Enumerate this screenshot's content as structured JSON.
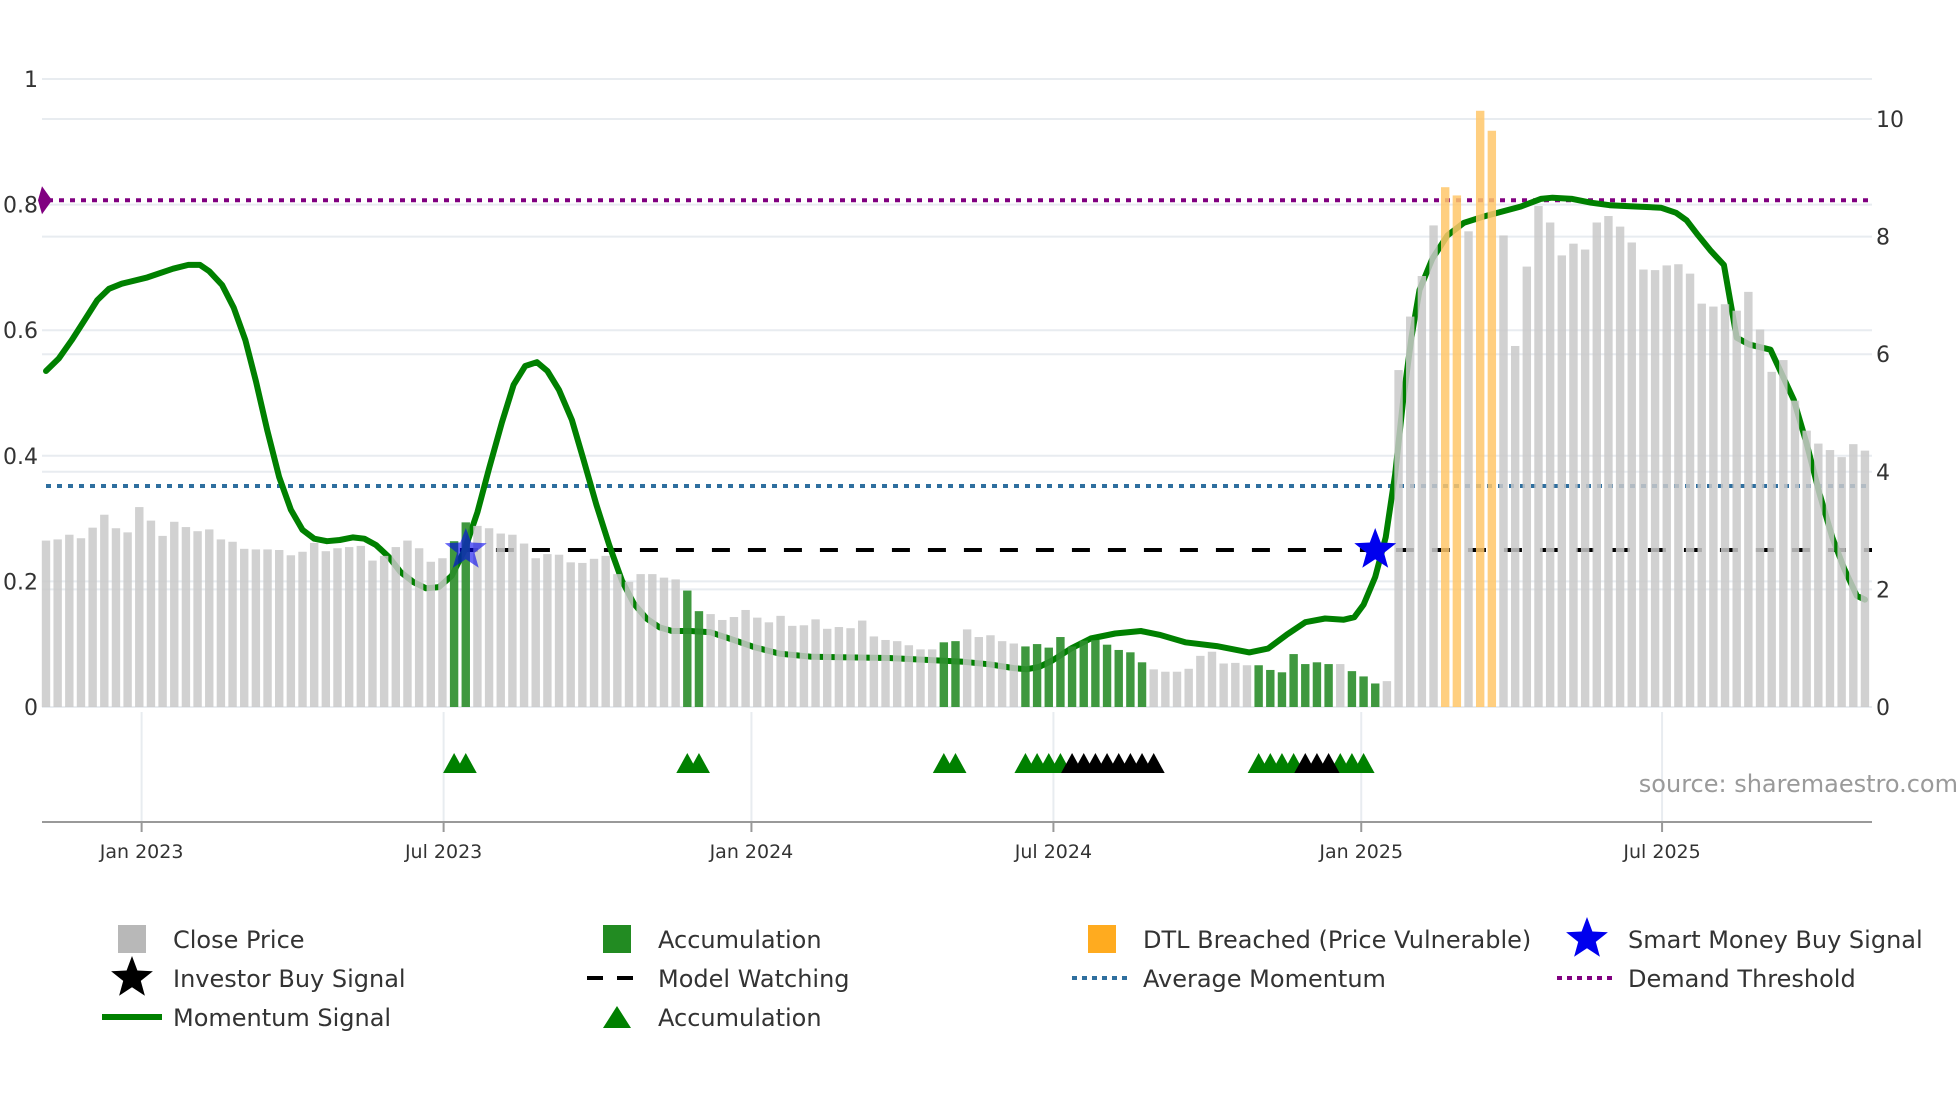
{
  "chart_data": {
    "type": "bar",
    "title": "",
    "x_unit": "week index (weekly bars)",
    "x_ticks": [
      {
        "label": "Jan 2023",
        "week": 8.2
      },
      {
        "label": "Jul 2023",
        "week": 34.1
      },
      {
        "label": "Jan 2024",
        "week": 60.5
      },
      {
        "label": "Jul 2024",
        "week": 86.4
      },
      {
        "label": "Jan 2025",
        "week": 112.8
      },
      {
        "label": "Jul 2025",
        "week": 138.6
      }
    ],
    "y_left": {
      "ticks": [
        "0",
        "0.2",
        "0.4",
        "0.6",
        "0.8",
        "1"
      ],
      "range": [
        0,
        1
      ]
    },
    "y_right": {
      "ticks": [
        "0",
        "2",
        "4",
        "6",
        "8",
        "10"
      ],
      "range": [
        0,
        10
      ]
    },
    "grid": true,
    "close_price": [
      2.83,
      2.85,
      2.93,
      2.87,
      3.05,
      3.27,
      3.04,
      2.97,
      3.4,
      3.17,
      2.91,
      3.15,
      3.06,
      2.99,
      3.02,
      2.85,
      2.81,
      2.69,
      2.68,
      2.68,
      2.67,
      2.58,
      2.64,
      2.79,
      2.65,
      2.7,
      2.72,
      2.74,
      2.49,
      2.57,
      2.72,
      2.83,
      2.7,
      2.47,
      2.53,
      2.82,
      3.14,
      3.08,
      3.04,
      2.95,
      2.93,
      2.78,
      2.53,
      2.6,
      2.59,
      2.46,
      2.45,
      2.52,
      2.57,
      2.26,
      2.13,
      2.26,
      2.26,
      2.2,
      2.17,
      1.98,
      1.63,
      1.58,
      1.48,
      1.53,
      1.65,
      1.52,
      1.44,
      1.55,
      1.38,
      1.39,
      1.49,
      1.33,
      1.36,
      1.34,
      1.47,
      1.2,
      1.14,
      1.12,
      1.05,
      0.98,
      0.98,
      1.1,
      1.12,
      1.32,
      1.19,
      1.22,
      1.12,
      1.08,
      1.03,
      1.07,
      1.01,
      1.19,
      1.03,
      1.13,
      1.14,
      1.06,
      0.97,
      0.93,
      0.76,
      0.64,
      0.6,
      0.6,
      0.65,
      0.87,
      0.94,
      0.74,
      0.75,
      0.71,
      0.71,
      0.63,
      0.59,
      0.9,
      0.73,
      0.76,
      0.73,
      0.73,
      0.61,
      0.52,
      0.4,
      0.44,
      5.73,
      6.64,
      7.33,
      8.19,
      8.84,
      8.7,
      8.09,
      10.14,
      9.8,
      8.02,
      6.14,
      7.49,
      8.52,
      8.24,
      7.68,
      7.88,
      7.78,
      8.24,
      8.35,
      8.17,
      7.9,
      7.44,
      7.43,
      7.51,
      7.53,
      7.37,
      6.86,
      6.81,
      6.85,
      6.74,
      7.06,
      6.42,
      5.7,
      5.9,
      5.21,
      4.7,
      4.48,
      4.37,
      4.25,
      4.47,
      4.36
    ],
    "accumulation_weeks": [
      35,
      36,
      55,
      56,
      77,
      78,
      84,
      85,
      86,
      87,
      88,
      89,
      90,
      91,
      92,
      93,
      94,
      104,
      105,
      106,
      107,
      108,
      109,
      110,
      112,
      113,
      114
    ],
    "dtl_breached_weeks": [
      120,
      121,
      123,
      124
    ],
    "momentum_signal": [
      [
        0,
        0.535
      ],
      [
        1.1,
        0.555
      ],
      [
        2.2,
        0.584
      ],
      [
        3.3,
        0.616
      ],
      [
        4.4,
        0.648
      ],
      [
        5.4,
        0.666
      ],
      [
        6.5,
        0.674
      ],
      [
        8.7,
        0.684
      ],
      [
        10.9,
        0.698
      ],
      [
        12.2,
        0.704
      ],
      [
        13.2,
        0.704
      ],
      [
        14.0,
        0.694
      ],
      [
        15.1,
        0.672
      ],
      [
        16.1,
        0.636
      ],
      [
        17.1,
        0.584
      ],
      [
        18.0,
        0.519
      ],
      [
        19.0,
        0.439
      ],
      [
        20.0,
        0.366
      ],
      [
        21.0,
        0.314
      ],
      [
        22.0,
        0.282
      ],
      [
        23.0,
        0.268
      ],
      [
        24.1,
        0.264
      ],
      [
        25.2,
        0.266
      ],
      [
        26.3,
        0.27
      ],
      [
        27.3,
        0.268
      ],
      [
        28.3,
        0.258
      ],
      [
        29.4,
        0.239
      ],
      [
        30.4,
        0.215
      ],
      [
        31.5,
        0.199
      ],
      [
        32.6,
        0.189
      ],
      [
        33.7,
        0.191
      ],
      [
        34.8,
        0.209
      ],
      [
        35.9,
        0.25
      ],
      [
        37.0,
        0.31
      ],
      [
        38.0,
        0.38
      ],
      [
        39.1,
        0.453
      ],
      [
        40.1,
        0.513
      ],
      [
        41.1,
        0.543
      ],
      [
        42.1,
        0.549
      ],
      [
        43.0,
        0.535
      ],
      [
        44.0,
        0.505
      ],
      [
        45.1,
        0.457
      ],
      [
        46.1,
        0.394
      ],
      [
        47.2,
        0.322
      ],
      [
        48.3,
        0.258
      ],
      [
        49.4,
        0.201
      ],
      [
        50.4,
        0.165
      ],
      [
        51.5,
        0.141
      ],
      [
        52.6,
        0.127
      ],
      [
        53.7,
        0.121
      ],
      [
        55.3,
        0.121
      ],
      [
        57.0,
        0.119
      ],
      [
        58.6,
        0.109
      ],
      [
        60.8,
        0.095
      ],
      [
        62.9,
        0.085
      ],
      [
        65.7,
        0.08
      ],
      [
        72.2,
        0.078
      ],
      [
        78.7,
        0.072
      ],
      [
        80.9,
        0.068
      ],
      [
        83.0,
        0.062
      ],
      [
        84.1,
        0.06
      ],
      [
        85.2,
        0.064
      ],
      [
        86.3,
        0.074
      ],
      [
        87.9,
        0.093
      ],
      [
        89.6,
        0.109
      ],
      [
        91.7,
        0.117
      ],
      [
        93.9,
        0.121
      ],
      [
        95.5,
        0.115
      ],
      [
        97.7,
        0.103
      ],
      [
        100.4,
        0.097
      ],
      [
        103.2,
        0.087
      ],
      [
        104.8,
        0.093
      ],
      [
        106.4,
        0.115
      ],
      [
        108.0,
        0.135
      ],
      [
        109.7,
        0.141
      ],
      [
        111.3,
        0.139
      ],
      [
        112.2,
        0.143
      ],
      [
        113.0,
        0.163
      ],
      [
        114.0,
        0.207
      ],
      [
        114.9,
        0.27
      ],
      [
        115.7,
        0.37
      ],
      [
        116.4,
        0.489
      ],
      [
        117.1,
        0.588
      ],
      [
        117.8,
        0.664
      ],
      [
        118.9,
        0.714
      ],
      [
        120.2,
        0.751
      ],
      [
        121.6,
        0.771
      ],
      [
        123.3,
        0.781
      ],
      [
        124.9,
        0.789
      ],
      [
        126.5,
        0.797
      ],
      [
        128.2,
        0.809
      ],
      [
        129.2,
        0.811
      ],
      [
        130.9,
        0.809
      ],
      [
        132.5,
        0.803
      ],
      [
        134.1,
        0.799
      ],
      [
        136.3,
        0.797
      ],
      [
        138.5,
        0.795
      ],
      [
        139.8,
        0.787
      ],
      [
        140.7,
        0.775
      ],
      [
        141.7,
        0.751
      ],
      [
        142.8,
        0.726
      ],
      [
        143.9,
        0.704
      ],
      [
        145.0,
        0.588
      ],
      [
        146.1,
        0.577
      ],
      [
        147.9,
        0.569
      ],
      [
        148.8,
        0.533
      ],
      [
        149.9,
        0.489
      ],
      [
        151.0,
        0.419
      ],
      [
        152.1,
        0.34
      ],
      [
        153.2,
        0.27
      ],
      [
        154.2,
        0.221
      ],
      [
        155.3,
        0.177
      ],
      [
        156.0,
        0.171
      ]
    ],
    "average_momentum": 0.352,
    "demand_threshold": 0.807,
    "model_watching": {
      "value": 0.25,
      "from_week": 35.5
    },
    "smart_money_buy_signals": [
      [
        36,
        0.25
      ],
      [
        114,
        0.25
      ]
    ],
    "accumulation_markers_green": [
      35,
      36,
      55,
      56,
      77,
      78,
      84,
      85,
      86,
      87,
      104,
      105,
      106,
      107,
      111,
      112,
      113
    ],
    "accumulation_markers_black": [
      88,
      89,
      90,
      91,
      92,
      93,
      94,
      95,
      108,
      109,
      110
    ],
    "source": "source: sharemaestro.com",
    "legend": [
      {
        "label": "Close Price",
        "icon": "gray-square"
      },
      {
        "label": "Accumulation",
        "icon": "green-square"
      },
      {
        "label": "DTL Breached (Price Vulnerable)",
        "icon": "orange-square"
      },
      {
        "label": "Smart Money Buy Signal",
        "icon": "blue-star"
      },
      {
        "label": "Investor Buy Signal",
        "icon": "black-star"
      },
      {
        "label": "Model Watching",
        "icon": "black-dashed-line"
      },
      {
        "label": "Average Momentum",
        "icon": "blue-dotted-line"
      },
      {
        "label": "Demand Threshold",
        "icon": "purple-dotted-line"
      },
      {
        "label": "Momentum Signal",
        "icon": "green-line"
      },
      {
        "label": "Accumulation",
        "icon": "green-triangle"
      }
    ],
    "legend_placement": "bottom"
  },
  "colors": {
    "close": "#c9c9c9",
    "accum": "#2f8f2f",
    "dtl": "#ffc76a",
    "momentum": "#008000",
    "avg": "#2f6f9f",
    "demand": "#800080",
    "watch": "#000000",
    "smart": "#0000ee",
    "grid": "#e8ecf0"
  }
}
